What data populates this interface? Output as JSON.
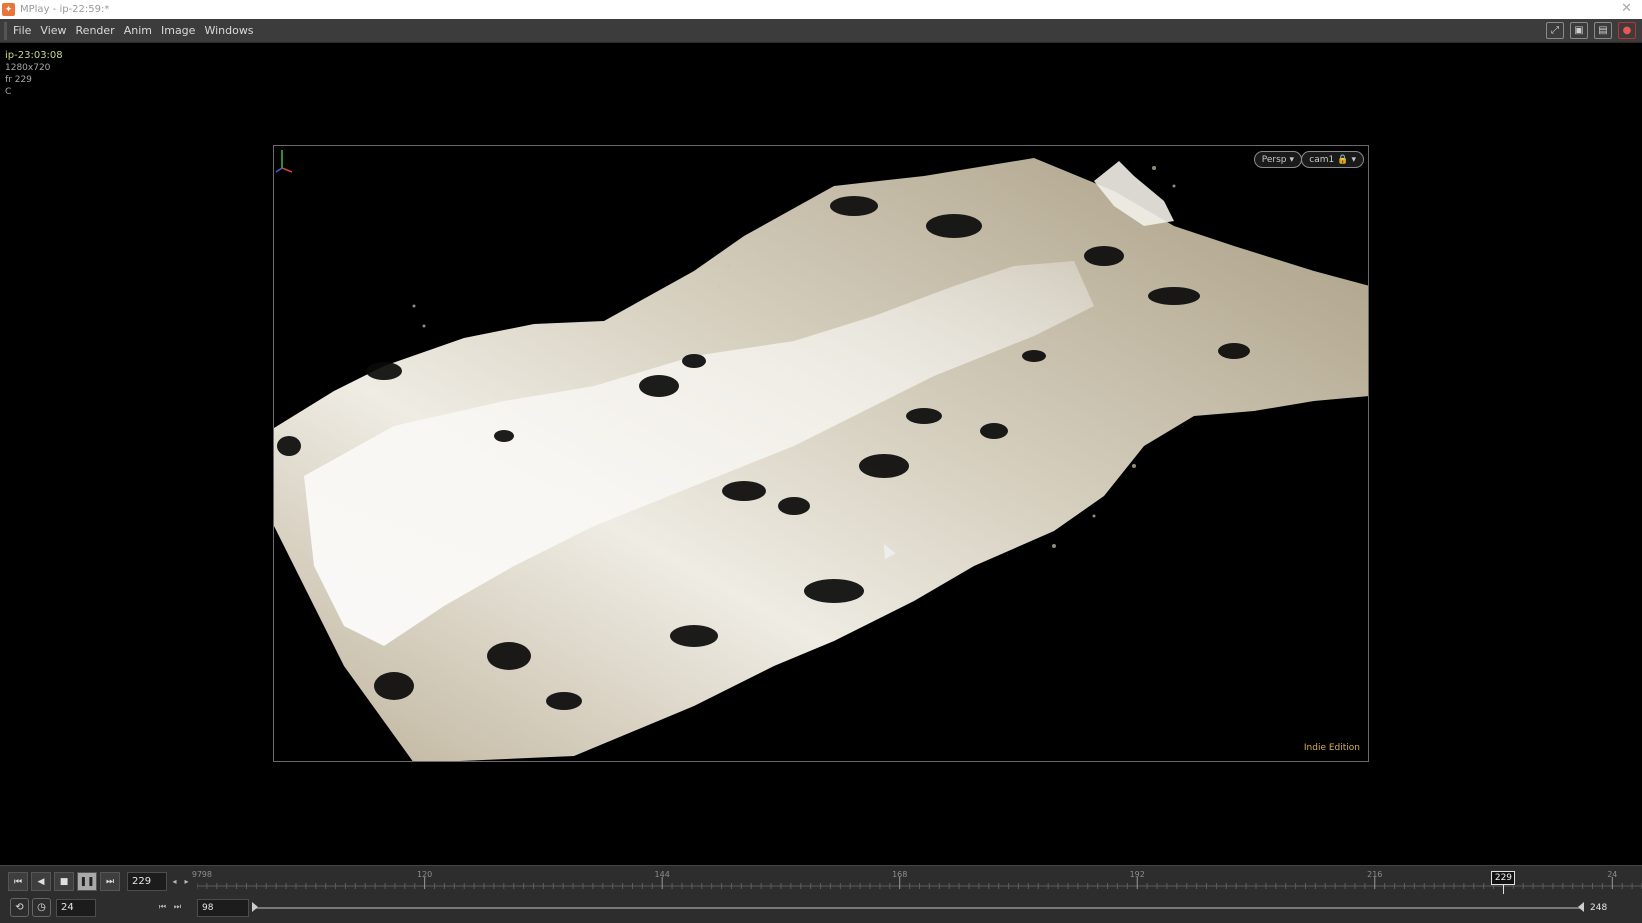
{
  "window": {
    "title": "MPlay - ip-22:59:*",
    "app_icon": "houdini-icon"
  },
  "menu": {
    "items": [
      "File",
      "View",
      "Render",
      "Anim",
      "Image",
      "Windows"
    ]
  },
  "toolbar_icons": [
    "fit-view-icon",
    "snapshot-icon",
    "flipbook-icon",
    "close-red-icon"
  ],
  "info": {
    "name": "ip-23:03:08",
    "resolution": "1280x720",
    "frame": "fr 229",
    "channel": "C"
  },
  "viewport": {
    "persp_label": "Persp",
    "cam_label": "cam1",
    "edition_label": "Indie Edition"
  },
  "playbar": {
    "current_frame": "229",
    "fps": "24",
    "range_start": "98",
    "range_end": "248",
    "ticks": [
      {
        "frame": 97,
        "label": "97"
      },
      {
        "frame": 98,
        "label": "98"
      },
      {
        "frame": 120,
        "label": "120"
      },
      {
        "frame": 144,
        "label": "144"
      },
      {
        "frame": 168,
        "label": "168"
      },
      {
        "frame": 192,
        "label": "192"
      },
      {
        "frame": 216,
        "label": "216"
      },
      {
        "frame": 240,
        "label": "24"
      }
    ],
    "cursor_frame": 229
  },
  "colors": {
    "accent_green": "#c5d88e",
    "edition_gold": "#d8b04a"
  }
}
